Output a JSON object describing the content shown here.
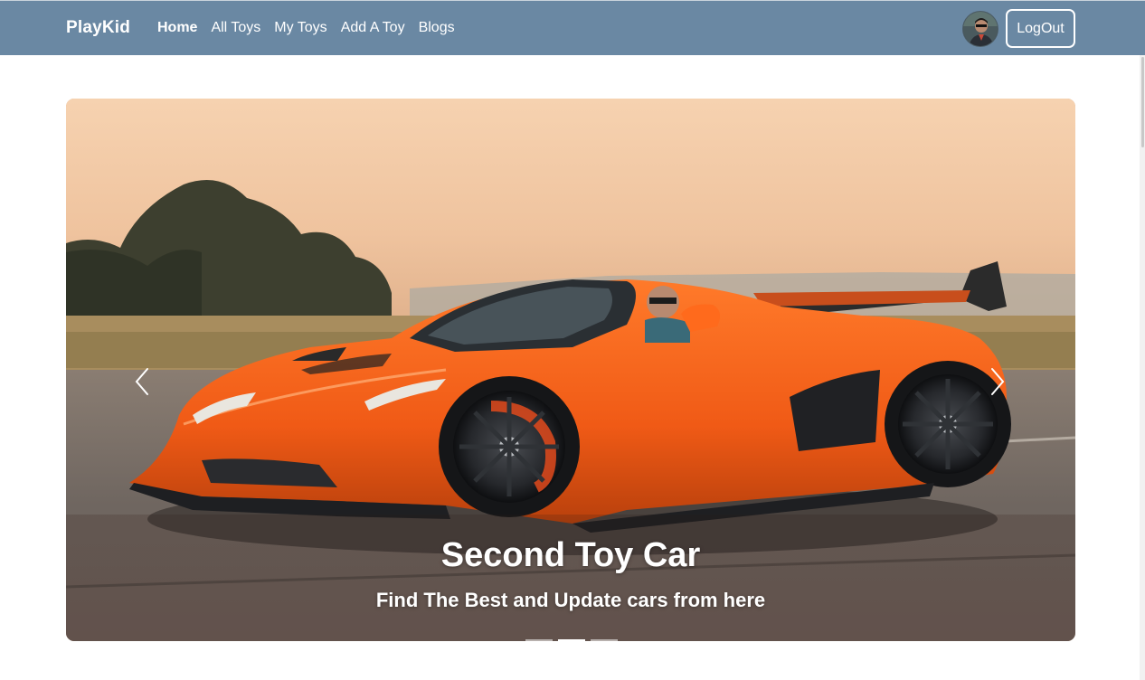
{
  "navbar": {
    "brand": "PlayKid",
    "links": [
      {
        "label": "Home",
        "active": true
      },
      {
        "label": "All Toys",
        "active": false
      },
      {
        "label": "My Toys",
        "active": false
      },
      {
        "label": "Add A Toy",
        "active": false
      },
      {
        "label": "Blogs",
        "active": false
      }
    ],
    "avatar_icon": "user-avatar",
    "logout_label": "LogOut",
    "background_color": "#6a88a3"
  },
  "carousel": {
    "slide_title": "Second Toy Car",
    "slide_subtitle": "Find The Best and Update cars from here",
    "prev_icon": "chevron-left-icon",
    "next_icon": "chevron-right-icon",
    "indicator_count": 3,
    "active_indicator": 2,
    "image_subject": "orange sports car on road at sunset"
  }
}
